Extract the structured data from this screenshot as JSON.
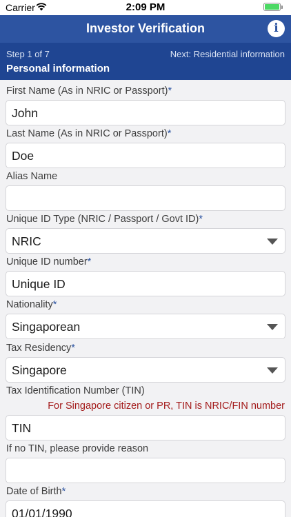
{
  "status_bar": {
    "carrier": "Carrier",
    "time": "2:09 PM"
  },
  "nav": {
    "title": "Investor Verification",
    "info_icon": "i"
  },
  "step": {
    "progress": "Step 1 of 7",
    "next": "Next: Residential information",
    "section": "Personal information"
  },
  "form": {
    "first_name": {
      "label": "First Name (As in NRIC or Passport)",
      "required": "*",
      "value": "John"
    },
    "last_name": {
      "label": "Last Name (As in NRIC or Passport)",
      "required": "*",
      "value": "Doe"
    },
    "alias_name": {
      "label": "Alias Name",
      "value": ""
    },
    "id_type": {
      "label": "Unique ID Type (NRIC / Passport / Govt ID)",
      "required": "*",
      "value": "NRIC"
    },
    "id_number": {
      "label": "Unique ID number",
      "required": "*",
      "placeholder": "Unique ID"
    },
    "nationality": {
      "label": "Nationality",
      "required": "*",
      "value": "Singaporean"
    },
    "tax_residency": {
      "label": "Tax Residency",
      "required": "*",
      "value": "Singapore"
    },
    "tin": {
      "label": "Tax Identification Number (TIN)",
      "hint": "For Singapore citizen or PR, TIN is NRIC/FIN number",
      "placeholder": "TIN"
    },
    "no_tin_reason": {
      "label": "If no TIN, please provide reason",
      "value": ""
    },
    "dob": {
      "label": "Date of Birth",
      "required": "*",
      "value": "01/01/1990"
    }
  }
}
